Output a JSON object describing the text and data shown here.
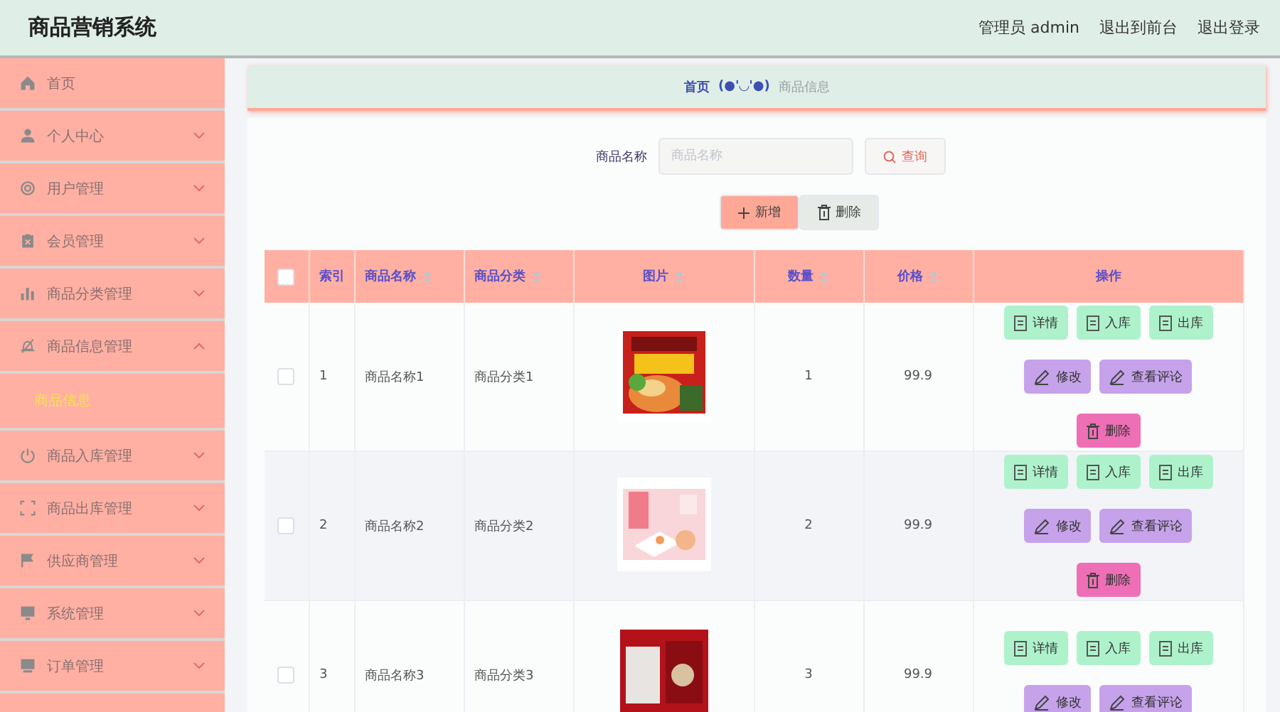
{
  "header": {
    "title": "商品营销系统",
    "user": "管理员 admin",
    "links": [
      "退出到前台",
      "退出登录"
    ]
  },
  "sidebar": {
    "items": [
      {
        "label": "首页",
        "kind": "link"
      },
      {
        "label": "个人中心",
        "kind": "menu",
        "expanded": false
      },
      {
        "label": "用户管理",
        "kind": "menu",
        "expanded": false
      },
      {
        "label": "会员管理",
        "kind": "menu",
        "expanded": false
      },
      {
        "label": "商品分类管理",
        "kind": "menu",
        "expanded": false
      },
      {
        "label": "商品信息管理",
        "kind": "menu",
        "expanded": true,
        "children": [
          {
            "label": "商品信息",
            "selected": true
          }
        ]
      },
      {
        "label": "商品入库管理",
        "kind": "menu",
        "expanded": false
      },
      {
        "label": "商品出库管理",
        "kind": "menu",
        "expanded": false
      },
      {
        "label": "供应商管理",
        "kind": "menu",
        "expanded": false
      },
      {
        "label": "系统管理",
        "kind": "menu",
        "expanded": false
      },
      {
        "label": "订单管理",
        "kind": "menu",
        "expanded": false
      }
    ]
  },
  "breadcrumb": {
    "home": "首页",
    "separator": "(●'◡'●)",
    "current": "商品信息"
  },
  "search": {
    "label": "商品名称",
    "placeholder": "商品名称",
    "button": "查询"
  },
  "toolbar": [
    {
      "label": "新增",
      "kind": "add"
    },
    {
      "label": "删除",
      "kind": "delete"
    }
  ],
  "table": {
    "select_all": {
      "checked": false
    },
    "columns": [
      {
        "label": "索引",
        "sortable": false
      },
      {
        "label": "商品名称",
        "sortable": true
      },
      {
        "label": "商品分类",
        "sortable": true
      },
      {
        "label": "图片",
        "sortable": true
      },
      {
        "label": "数量",
        "sortable": true
      },
      {
        "label": "价格",
        "sortable": true
      },
      {
        "label": "操作",
        "sortable": false
      }
    ],
    "rows": [
      {
        "checked": false,
        "index": "1",
        "name": "商品名称1",
        "category": "商品分类1",
        "image": {
          "kind": "picture"
        },
        "quantity": "1",
        "price": "99.9",
        "actions": [
          {
            "label": "详情",
            "kind": "info"
          },
          {
            "label": "入库",
            "kind": "info"
          },
          {
            "label": "出库",
            "kind": "info"
          },
          {
            "label": "修改",
            "kind": "edit"
          },
          {
            "label": "查看评论",
            "kind": "edit"
          },
          {
            "label": "删除",
            "kind": "danger"
          }
        ]
      },
      {
        "checked": false,
        "index": "2",
        "name": "商品名称2",
        "category": "商品分类2",
        "image": {
          "kind": "picture"
        },
        "quantity": "2",
        "price": "99.9",
        "actions": [
          {
            "label": "详情",
            "kind": "info"
          },
          {
            "label": "入库",
            "kind": "info"
          },
          {
            "label": "出库",
            "kind": "info"
          },
          {
            "label": "修改",
            "kind": "edit"
          },
          {
            "label": "查看评论",
            "kind": "edit"
          },
          {
            "label": "删除",
            "kind": "danger"
          }
        ]
      },
      {
        "checked": false,
        "index": "3",
        "name": "商品名称3",
        "category": "商品分类3",
        "image": {
          "kind": "picture"
        },
        "quantity": "3",
        "price": "99.9",
        "actions": [
          {
            "label": "详情",
            "kind": "info"
          },
          {
            "label": "入库",
            "kind": "info"
          },
          {
            "label": "出库",
            "kind": "info"
          },
          {
            "label": "修改",
            "kind": "edit"
          },
          {
            "label": "查看评论",
            "kind": "edit"
          }
        ]
      }
    ]
  }
}
